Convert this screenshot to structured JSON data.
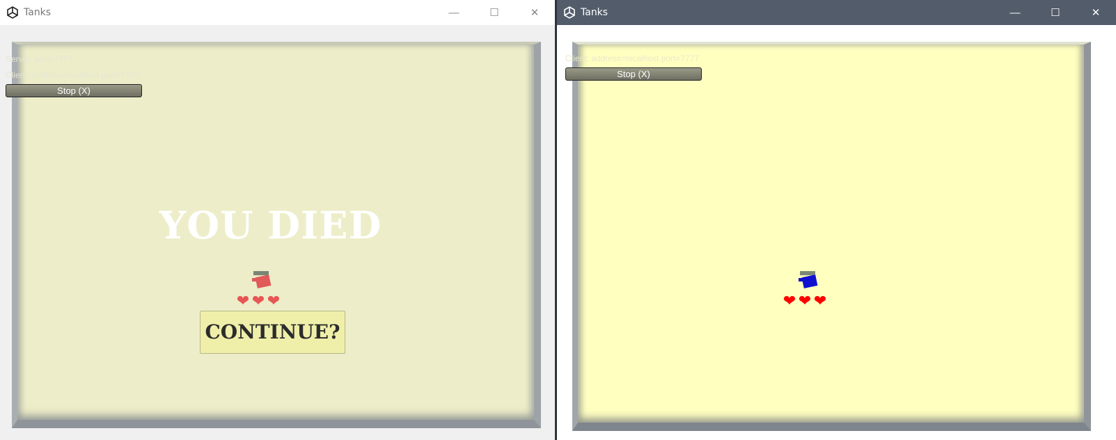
{
  "windows": [
    {
      "title": "Tanks",
      "server_text": "Server: port=7777",
      "client_text": "Client: address=localhost port=7777",
      "stop_label": "Stop (X)",
      "overlay_text": "YOU DIED",
      "continue_label": "CONTINUE?",
      "tank_color": "#e05a5a",
      "heart_color": "#e85555",
      "hearts": 3
    },
    {
      "title": "Tanks",
      "client_text": "Client: address=localhost port=7777",
      "stop_label": "Stop (X)",
      "tank_color": "#1010d0",
      "heart_color": "#ff0000",
      "hearts": 3
    }
  ],
  "icons": {
    "logo": "unity-logo-icon",
    "minimize": "minimize-icon",
    "maximize": "maximize-icon",
    "close": "close-icon",
    "heart": "heart-icon"
  },
  "glyphs": {
    "minimize": "—",
    "maximize": "☐",
    "close": "✕",
    "heart": "❤"
  }
}
